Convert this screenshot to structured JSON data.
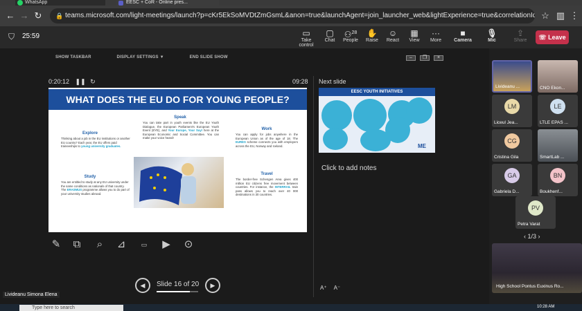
{
  "browser": {
    "tabs": [
      {
        "label": "WhatsApp"
      },
      {
        "label": "EESC + CoR - Online pres..."
      }
    ],
    "url": "teams.microsoft.com/light-meetings/launch?p=cKr5EkSoMVDtZmGsmL&anon=true&launchAgent=join_launcher_web&lightExperience=true&correlationId=180b6e97-f9ef-4fd3-b193-58e6da..."
  },
  "meeting": {
    "duration": "25:59",
    "toolbar": [
      {
        "label": "Take control",
        "icon": "take-control-icon"
      },
      {
        "label": "Chat",
        "icon": "chat-icon"
      },
      {
        "label": "People",
        "icon": "people-icon",
        "count": "28"
      },
      {
        "label": "Raise",
        "icon": "raise-hand-icon"
      },
      {
        "label": "React",
        "icon": "react-icon"
      },
      {
        "label": "View",
        "icon": "view-icon"
      },
      {
        "label": "More",
        "icon": "more-icon"
      },
      {
        "label": "Camera",
        "icon": "camera-icon"
      },
      {
        "label": "Mic",
        "icon": "mic-icon"
      },
      {
        "label": "Share",
        "icon": "share-icon"
      }
    ],
    "leave_label": "Leave"
  },
  "presenter": {
    "top_controls": [
      "SHOW TASKBAR",
      "DISPLAY SETTINGS ▼",
      "END SLIDE SHOW"
    ],
    "elapsed": "0:20:12",
    "clock": "09:28",
    "next_label": "Next slide",
    "notes_placeholder": "Click to add notes",
    "slide_counter": "Slide 16 of 20",
    "slide_progress": 0.8,
    "slide": {
      "title": "WHAT DOES THE EU DO FOR YOUNG PEOPLE?",
      "speak_head": "Speak",
      "speak_text": "You can take part in youth events like the EU Youth Dialogue, the European Parliament's European Youth Event (EYE), and",
      "speak_hl": "Your Europe, Your Say!",
      "speak_text2": "here at the European Economic and Social Committee. You can make your voice heard!",
      "explore_head": "Explore",
      "explore_text": "Thinking about a job in the EU institutions or another EU country? Each year, the EU offers paid traineeships to",
      "explore_hl": "young university graduates.",
      "work_head": "Work",
      "work_text": "You can apply for jobs anywhere in the European Union as of the age of 18. The",
      "work_hl": "EURES",
      "work_text2": "scheme connects you with employers across the EU, Norway and Iceland.",
      "study_head": "Study",
      "study_text": "You are entitled to study at any EU university under the same conditions as nationals of that country. The",
      "study_hl": "ERASMUS",
      "study_text2": "programme allows you to do part of your university studies abroad.",
      "travel_head": "Travel",
      "travel_text": "The border-free Schengen Area gives 400 million EU citizens free movement between countries. For instance, the",
      "travel_hl": "INTERRAIL",
      "travel_text2": "train pass allows you to reach over 40 000 destinations in 30 countries."
    },
    "next_slide_title": "EESC YOUTH INITIATIVES",
    "next_slide_logo": "ME"
  },
  "participants": [
    {
      "name": "Livideanu ...",
      "initials": ""
    },
    {
      "name": "CNO Ekon...",
      "initials": ""
    },
    {
      "name": "Liceul Jea...",
      "initials": "LM",
      "color": "#e8d9a8"
    },
    {
      "name": "LTLE EPAS ...",
      "initials": "LE",
      "color": "#cfe0f0"
    },
    {
      "name": "Cristina Gila",
      "initials": "CG",
      "color": "#f0c9a0"
    },
    {
      "name": "SmartLab ...",
      "initials": ""
    },
    {
      "name": "Gabriela D...",
      "initials": "GA",
      "color": "#d8cbe8"
    },
    {
      "name": "Boukhenf...",
      "initials": "BN",
      "color": "#f3c3c9"
    },
    {
      "name": "Petra Varat",
      "initials": "PV",
      "color": "#dfe8c8"
    }
  ],
  "pager": "1/3",
  "big_tile_name": "High School Pontus Euxinus Ro...",
  "self_name": "Livideanu Simona Elena",
  "taskbar": {
    "search_placeholder": "Type here to search",
    "time": "10:28 AM"
  }
}
